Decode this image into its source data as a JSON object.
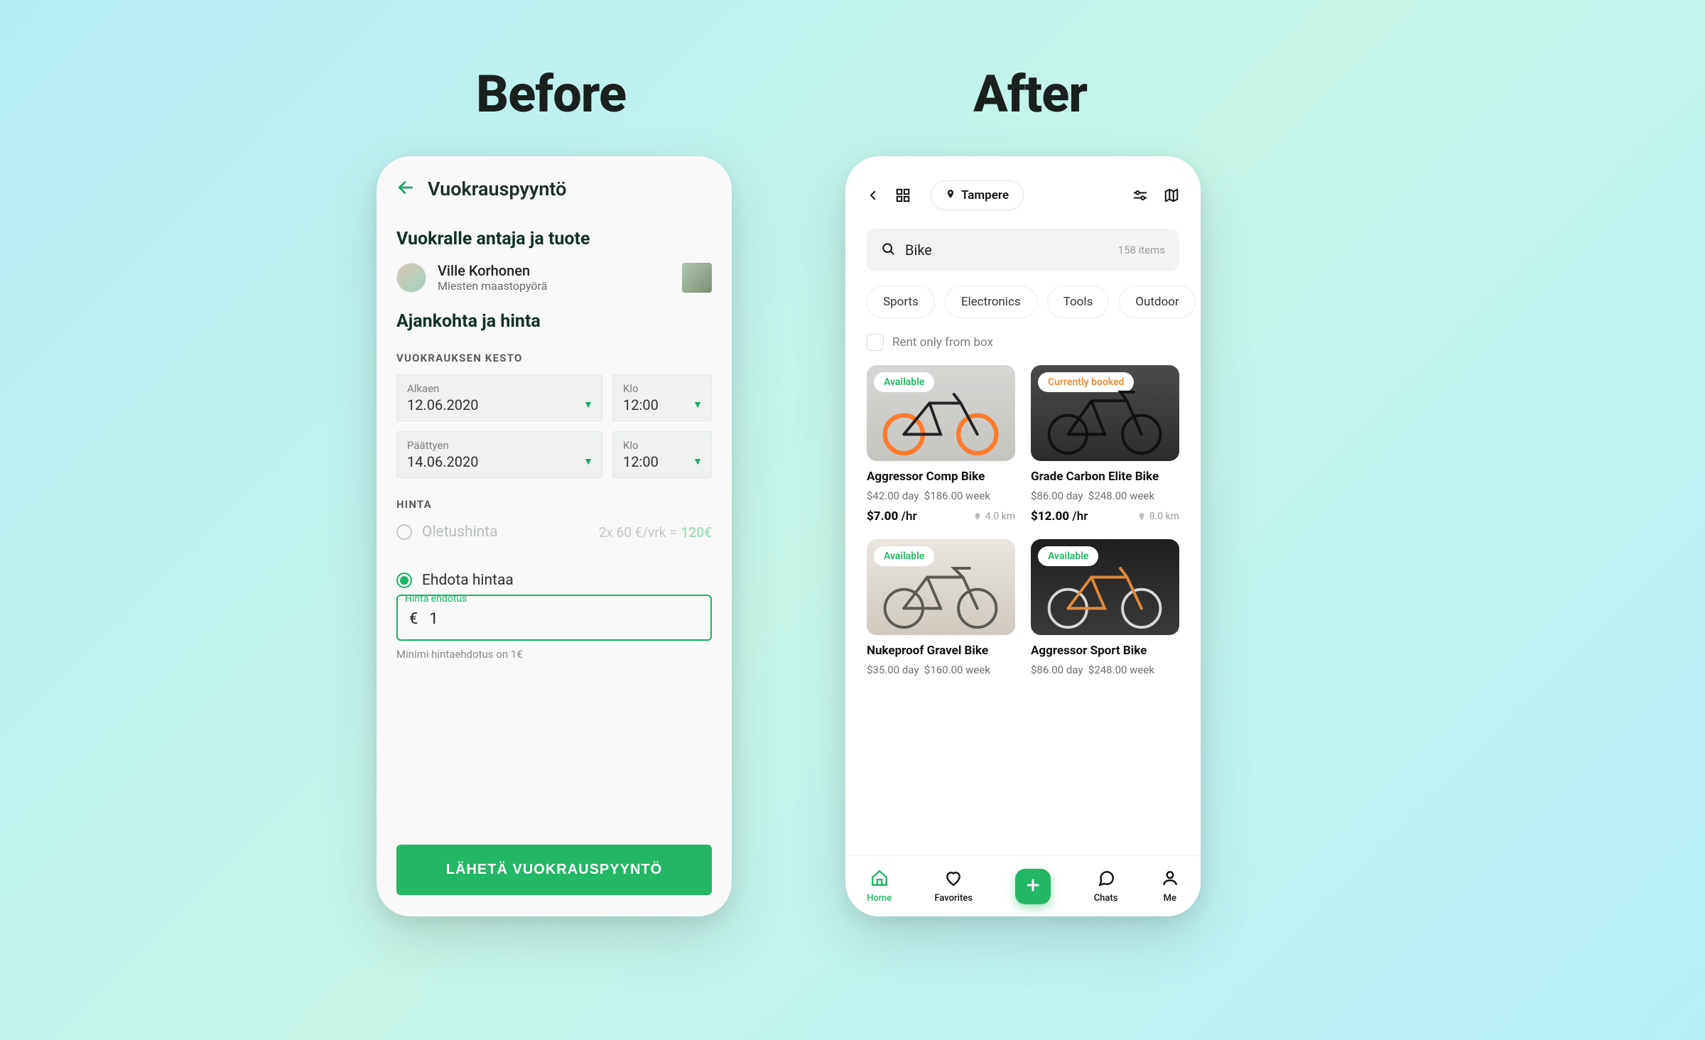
{
  "headings": {
    "before": "Before",
    "after": "After"
  },
  "before": {
    "appbar_title": "Vuokrauspyyntö",
    "section1_title": "Vuokralle antaja ja tuote",
    "owner_name": "Ville Korhonen",
    "owner_item": "Miesten maastopyörä",
    "section2_title": "Ajankohta ja hinta",
    "duration_label": "VUOKRAUKSEN KESTO",
    "from_label": "Alkaen",
    "from_value": "12.06.2020",
    "from_time_label": "Klo",
    "from_time_value": "12:00",
    "to_label": "Päättyen",
    "to_value": "14.06.2020",
    "to_time_label": "Klo",
    "to_time_value": "12:00",
    "price_label": "HINTA",
    "default_price_label": "Oletushinta",
    "calc_text": "2x 60 €/vrk =",
    "calc_total": "120€",
    "suggest_label": "Ehdota hintaa",
    "input_float_label": "Hinta ehdotus",
    "currency": "€",
    "input_value": "1",
    "hint": "Minimi hintaehdotus on 1€",
    "submit": "LÄHETÄ VUOKRAUSPYYNTÖ"
  },
  "after": {
    "location": "Tampere",
    "search_query": "Bike",
    "result_count": "158 items",
    "categories": [
      "Sports",
      "Electronics",
      "Tools",
      "Outdoor"
    ],
    "rent_box_label": "Rent only from box",
    "cards": [
      {
        "badge": "Available",
        "badge_kind": "avail",
        "name": "Aggressor Comp Bike",
        "day": "$42.00 day",
        "week": "$186.00 week",
        "rate": "$7.00",
        "unit": "/hr",
        "dist": "4.0 km"
      },
      {
        "badge": "Currently booked",
        "badge_kind": "booked",
        "name": "Grade Carbon Elite Bike",
        "day": "$86.00 day",
        "week": "$248.00 week",
        "rate": "$12.00",
        "unit": "/hr",
        "dist": "8.0 km"
      },
      {
        "badge": "Available",
        "badge_kind": "avail",
        "name": "Nukeproof Gravel Bike",
        "day": "$35.00 day",
        "week": "$160.00 week",
        "rate": "",
        "unit": "",
        "dist": ""
      },
      {
        "badge": "Available",
        "badge_kind": "avail",
        "name": "Aggressor Sport Bike",
        "day": "$86.00 day",
        "week": "$248.00 week",
        "rate": "",
        "unit": "",
        "dist": ""
      }
    ],
    "tabs": {
      "home": "Home",
      "favorites": "Favorites",
      "chats": "Chats",
      "me": "Me"
    }
  }
}
